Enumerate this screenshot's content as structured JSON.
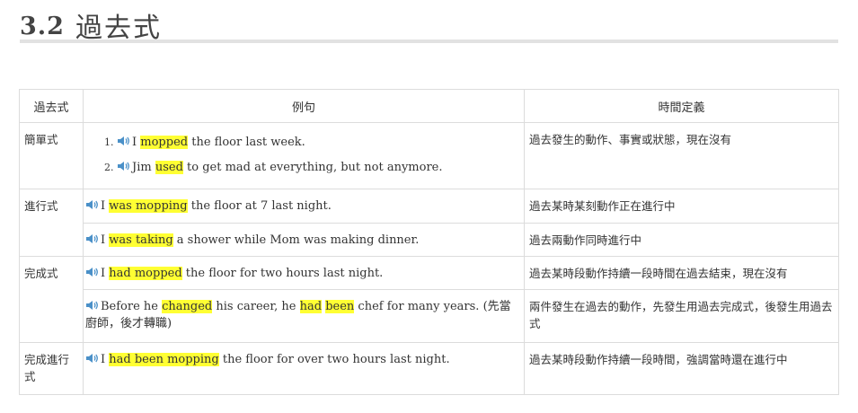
{
  "heading": {
    "number": "3.2",
    "title": "過去式"
  },
  "table": {
    "headers": {
      "tense": "過去式",
      "example": "例句",
      "definition": "時間定義"
    },
    "simple": {
      "tense": "簡單式",
      "ex1": {
        "pre": "I ",
        "hl": "mopped",
        "post": " the floor last week."
      },
      "ex2": {
        "pre": "Jim ",
        "hl": "used",
        "post": " to get mad at everything, but not anymore."
      },
      "definition": "過去發生的動作、事實或狀態，現在沒有"
    },
    "progressive": {
      "tense": "進行式",
      "ex1": {
        "pre": "I ",
        "hl": "was mopping",
        "post": " the floor at 7 last night."
      },
      "def1": "過去某時某刻動作正在進行中",
      "ex2": {
        "pre": "I ",
        "hl": "was taking",
        "post": " a shower while Mom was making dinner."
      },
      "def2": "過去兩動作同時進行中"
    },
    "perfect": {
      "tense": "完成式",
      "ex1": {
        "pre": "I ",
        "hl": "had mopped",
        "post": " the floor for two hours last night."
      },
      "def1": "過去某時段動作持續一段時間在過去結束，現在沒有",
      "ex2": {
        "pre": "Before he ",
        "hl1": "changed",
        "mid1": " his career, he ",
        "hl2": "had",
        "mid2": " ",
        "hl3": "been",
        "post": " chef for many years. (先當廚師，後才轉職)"
      },
      "def2": "兩件發生在過去的動作，先發生用過去完成式，後發生用過去式"
    },
    "perfect_progressive": {
      "tense": "完成進行式",
      "ex1": {
        "pre": "I ",
        "hl": "had been mopping",
        "post": " the floor for over two hours last night."
      },
      "definition": "過去某時段動作持續一段時間，強調當時還在進行中"
    }
  },
  "icons": {
    "audio": "speaker-icon",
    "color": "#4a90c8"
  }
}
